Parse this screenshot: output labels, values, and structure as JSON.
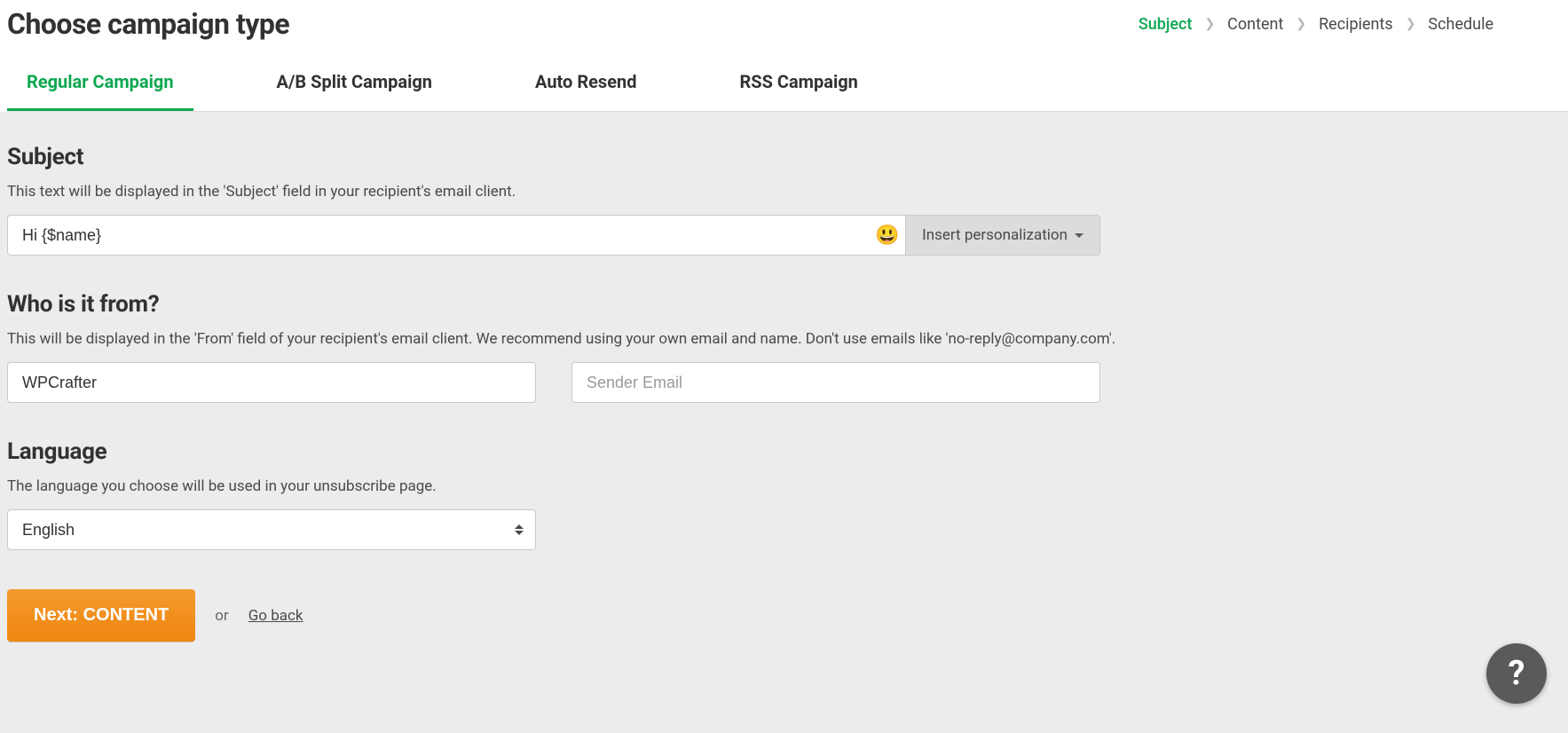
{
  "header": {
    "title": "Choose campaign type"
  },
  "breadcrumb": {
    "steps": [
      "Subject",
      "Content",
      "Recipients",
      "Schedule"
    ],
    "active_index": 0
  },
  "tabs": {
    "items": [
      "Regular Campaign",
      "A/B Split Campaign",
      "Auto Resend",
      "RSS Campaign"
    ],
    "active_index": 0
  },
  "subject_section": {
    "title": "Subject",
    "description": "This text will be displayed in the 'Subject' field in your recipient's email client.",
    "value": "Hi {$name}",
    "emoji_icon": "😃",
    "personalization_label": "Insert personalization"
  },
  "from_section": {
    "title": "Who is it from?",
    "description": "This will be displayed in the 'From' field of your recipient's email client. We recommend using your own email and name. Don't use emails like 'no-reply@company.com'.",
    "name_value": "WPCrafter",
    "email_value": "",
    "email_placeholder": "Sender Email"
  },
  "language_section": {
    "title": "Language",
    "description": "The language you choose will be used in your unsubscribe page.",
    "selected": "English"
  },
  "actions": {
    "primary": "Next: CONTENT",
    "or": "or",
    "back": "Go back"
  },
  "help": {
    "label": "?"
  }
}
